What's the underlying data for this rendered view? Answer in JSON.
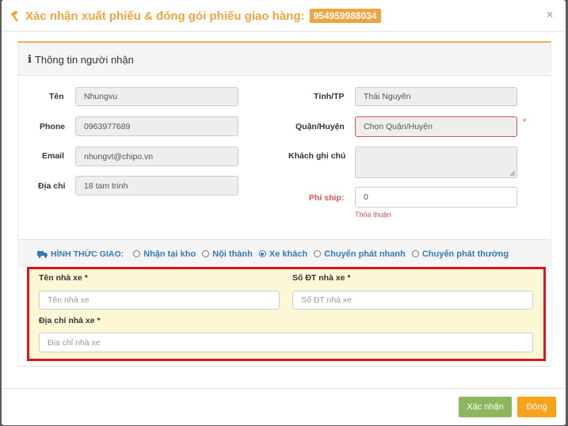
{
  "header": {
    "title": "Xác nhận xuất phiếu & đóng gói phiếu giao hàng:",
    "order_code": "954959988034",
    "close_symbol": "×",
    "title_color": "#f0a33e"
  },
  "recipient": {
    "heading": "Thông tin người nhận",
    "name_label": "Tên",
    "name_value": "Nhungvu",
    "phone_label": "Phone",
    "phone_value": "0963977689",
    "email_label": "Email",
    "email_value": "nhungvt@chipo.vn",
    "address_label": "Địa chỉ",
    "address_value": "18 tam trinh",
    "province_label": "Tỉnh/TP",
    "province_value": "Thái Nguyên",
    "district_label": "Quận/Huyện",
    "district_value": "Chọn Quận/Huyện",
    "district_required": "*",
    "note_label": "Khách ghi chú",
    "note_value": "",
    "ship_fee_label": "Phí ship:",
    "ship_fee_value": "0",
    "ship_fee_help": "Thỏa thuận"
  },
  "shipping": {
    "label": "HÌNH THỨC GIAO:",
    "options": [
      {
        "label": "Nhận tại kho",
        "selected": false
      },
      {
        "label": "Nội thành",
        "selected": false
      },
      {
        "label": "Xe khách",
        "selected": true
      },
      {
        "label": "Chuyển phát nhanh",
        "selected": false
      },
      {
        "label": "Chuyển phát thường",
        "selected": false
      }
    ]
  },
  "carrier": {
    "name_label": "Tên nhà xe *",
    "name_placeholder": "Tên nhà xe",
    "phone_label": "Số ĐT nhà xe *",
    "phone_placeholder": "Số ĐT nhà xe",
    "address_label": "Địa chỉ nhà xe *",
    "address_placeholder": "Địa chỉ nhà xe",
    "highlight_color": "#e0131b"
  },
  "footer": {
    "confirm_label": "Xác nhận",
    "close_label": "Đóng",
    "confirm_color": "#8bb85f",
    "close_color": "#f7a21a"
  },
  "icons": [
    "hammer-icon",
    "info-icon",
    "truck-icon",
    "close-icon"
  ]
}
